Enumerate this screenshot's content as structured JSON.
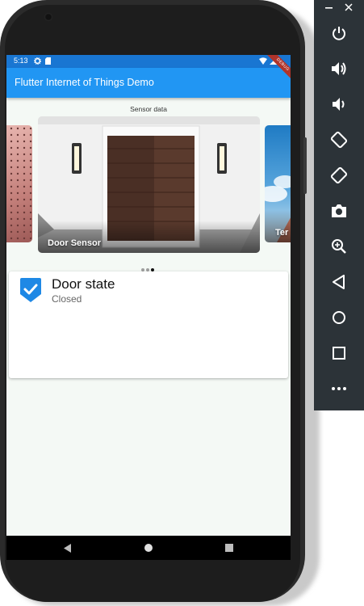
{
  "status_bar": {
    "time": "5:13"
  },
  "app_bar": {
    "title": "Flutter Internet of Things Demo",
    "debug_banner": "DEBUG"
  },
  "carousel": {
    "heading": "Sensor data",
    "cards": [
      {
        "label": ""
      },
      {
        "label": "Door Sensor"
      },
      {
        "label": "Ter"
      }
    ],
    "active_page": 3,
    "page_count": 3
  },
  "sensor_state": {
    "title": "Door state",
    "value": "Closed",
    "checked": true
  },
  "colors": {
    "primary": "#2196f3",
    "status_bar": "#1976d2",
    "checkbox": "#1e88e5",
    "toolbar": "#2c3338",
    "background": "#f4f9f5"
  },
  "emulator_toolbar": {
    "icons": [
      "minimize-icon",
      "close-icon",
      "power-icon",
      "volume-up-icon",
      "volume-down-icon",
      "rotate-left-icon",
      "rotate-right-icon",
      "camera-icon",
      "zoom-icon",
      "back-icon",
      "home-icon",
      "overview-icon",
      "more-icon"
    ]
  },
  "nav_bar": {
    "icons": [
      "back-icon",
      "home-icon",
      "recents-icon"
    ]
  }
}
